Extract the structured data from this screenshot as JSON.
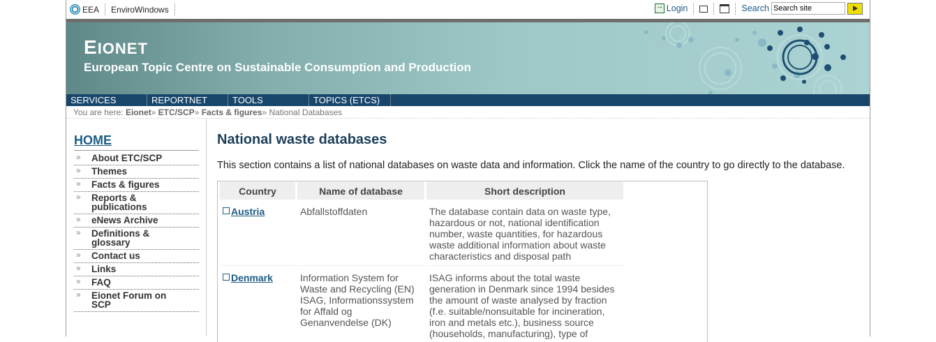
{
  "topbar": {
    "left_links": [
      "EEA",
      "EnviroWindows"
    ],
    "login_label": "Login",
    "search_label": "Search",
    "search_value": "Search site"
  },
  "banner": {
    "title_initial": "E",
    "title_rest": "IONET",
    "subtitle": "European Topic Centre on Sustainable Consumption and Production"
  },
  "nav": [
    "SERVICES",
    "REPORTNET",
    "TOOLS",
    "TOPICS (ETCS)"
  ],
  "breadcrumb": {
    "prefix": "You are here:",
    "items": [
      "Eionet",
      "ETC/SCP",
      "Facts & figures"
    ],
    "current": "National Databases",
    "separator": "»"
  },
  "sidebar": {
    "home": "HOME",
    "bullet": "»",
    "items": [
      "About ETC/SCP",
      "Themes",
      "Facts & figures",
      "Reports & publications",
      "eNews Archive",
      "Definitions & glossary",
      "Contact us",
      "Links",
      "FAQ",
      "Eionet Forum on SCP"
    ]
  },
  "main": {
    "heading": "National waste databases",
    "intro": "This section contains a list of national databases on waste data and information. Click the name of the country to go directly to the database.",
    "table": {
      "headers": [
        "Country",
        "Name of database",
        "Short description"
      ],
      "rows": [
        {
          "country": "Austria",
          "name": "Abfallstoffdaten",
          "description": "The database contain data on waste type, hazardous or not, national identification number, waste quantities, for hazardous waste additional information about waste characteristics and disposal path"
        },
        {
          "country": "Denmark",
          "name": "Information System for Waste and Recycling (EN) ISAG, Informationssystem for Affald og Genanvendelse (DK)",
          "description": "ISAG informs about the total waste generation in Denmark since 1994 besides the amount of waste analysed by fraction (f.e. suitable/nonsuitable for incineration, iron and metals etc.), business source (households, manufacturing), type of"
        }
      ]
    }
  }
}
